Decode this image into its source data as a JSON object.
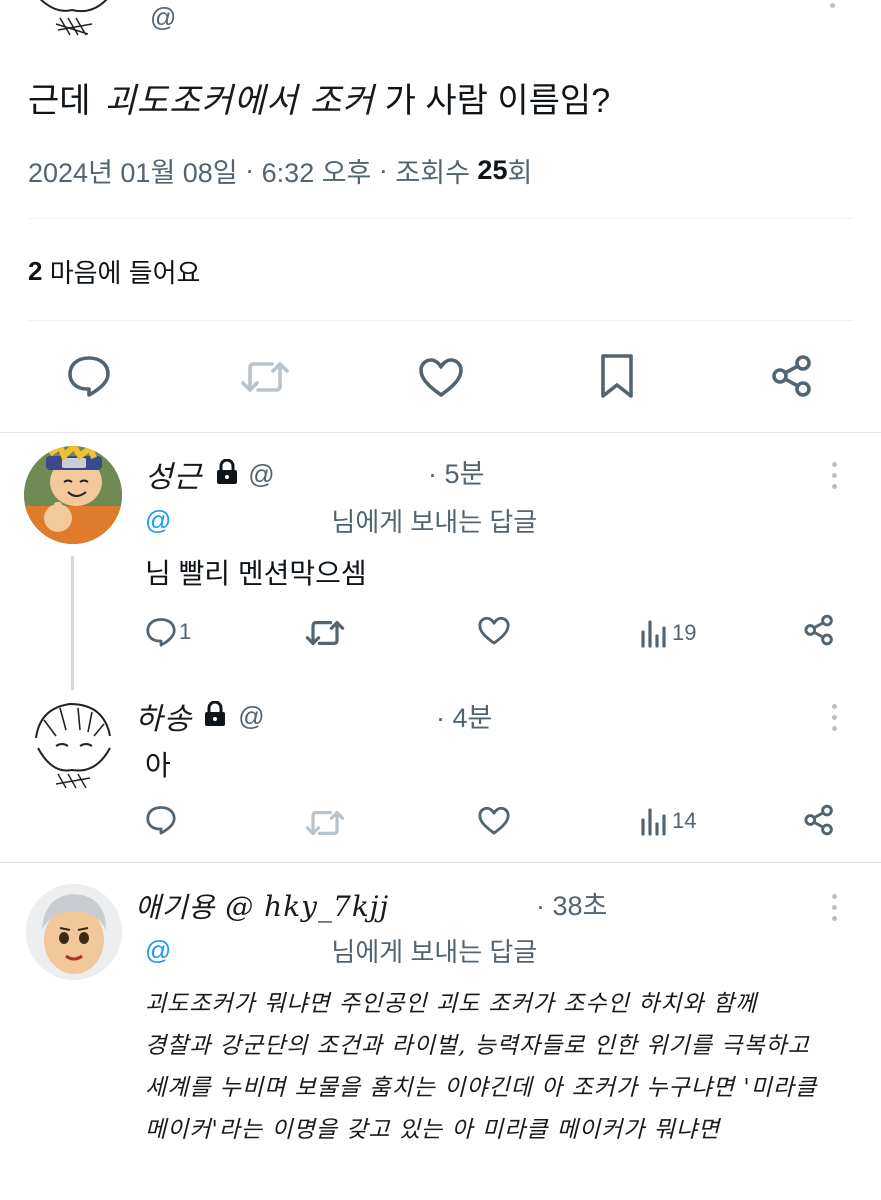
{
  "header": {
    "handle_prefix": "@"
  },
  "tweet": {
    "text_before": "근데",
    "text_handwritten": "괴도조커에서 조커",
    "text_after": "가 사람 이름임?",
    "date": "2024년 01월 08일",
    "sep1": " · ",
    "time": "6:32 오후",
    "sep2": " · ",
    "views_label": "조회수 ",
    "views_count": "25",
    "views_unit": "회",
    "likes_count": "2",
    "likes_label": " 마음에 들어요"
  },
  "replies": [
    {
      "name": "성근",
      "handle": "@",
      "time": "· 5분",
      "reply_to_at": "@",
      "reply_to_label": "님에게 보내는 답글",
      "text": "님 빨리 멘션막으셈",
      "reply_count": "1",
      "views": "19"
    },
    {
      "name": "하송",
      "handle": "@",
      "time": "· 4분",
      "text": "아",
      "views": "14"
    },
    {
      "name": "애기용",
      "handle": "@ hky_7kjj",
      "time": "· 38초",
      "reply_to_at": "@",
      "reply_to_label": "님에게 보내는 답글",
      "lines": [
        "괴도조커가 뭐냐면  주인공인  괴도 조커가  조수인  하치와  함께",
        "경찰과 강군단의 조건과 라이벌, 능력자들로 인한  위기를  극복하고",
        "세계를 누비며  보물을 훔치는  이야긴데  아  조커가  누구냐면  '미라클",
        "메이커'라는  이명을  갖고  있는  아  미라클 메이커가  뭐냐면"
      ]
    }
  ],
  "colors": {
    "text": "#0f1419",
    "muted": "#536471",
    "accent": "#1d9bf0",
    "thread_line": "#cfd9de"
  }
}
